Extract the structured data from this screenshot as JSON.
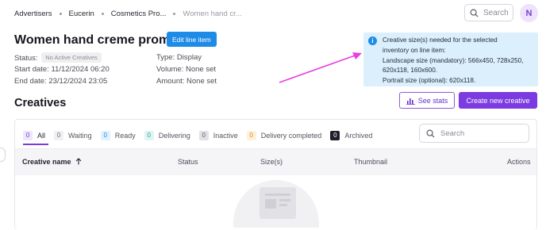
{
  "breadcrumb": [
    "Advertisers",
    "Eucerin",
    "Cosmetics Pro...",
    "Women hand cr..."
  ],
  "top_search": {
    "placeholder": "Search"
  },
  "avatar": {
    "initial": "N"
  },
  "line_item": {
    "title": "Women hand creme promo",
    "edit_label": "Edit line item",
    "status_label": "Status:",
    "status_value": "No Active Creatives",
    "start_label": "Start date:",
    "start_value": "11/12/2024 06:20",
    "end_label": "End date:",
    "end_value": "23/12/2024 23:05",
    "type_label": "Type:",
    "type_value": "Display",
    "volume_label": "Volume:",
    "volume_value": "None set",
    "amount_label": "Amount:",
    "amount_value": "None set"
  },
  "callout": {
    "icon": "info-icon",
    "line1": "Creative size(s) needed for the selected",
    "line2": "inventory on line item:",
    "line3": "Landscape size (mandatory): 566x450, 728x250,",
    "line4": "620x118, 160x600.",
    "line5": "Portrait size (optional): 620x118."
  },
  "annotation_arrow_color": "#e83ee0",
  "creatives": {
    "title": "Creatives",
    "stats_label": "See stats",
    "create_label": "Create new creative",
    "tabs": [
      {
        "count": "0",
        "label": "All"
      },
      {
        "count": "0",
        "label": "Waiting"
      },
      {
        "count": "0",
        "label": "Ready"
      },
      {
        "count": "0",
        "label": "Delivering"
      },
      {
        "count": "0",
        "label": "Inactive"
      },
      {
        "count": "0",
        "label": "Delivery completed"
      },
      {
        "count": "0",
        "label": "Archived"
      }
    ],
    "search_placeholder": "Search",
    "columns": {
      "name": "Creative name",
      "status": "Status",
      "sizes": "Size(s)",
      "thumbnail": "Thumbnail",
      "actions": "Actions"
    }
  },
  "colors": {
    "primary_purple": "#7b3be0",
    "primary_blue": "#1e8be6",
    "callout_bg": "#dceffc"
  }
}
